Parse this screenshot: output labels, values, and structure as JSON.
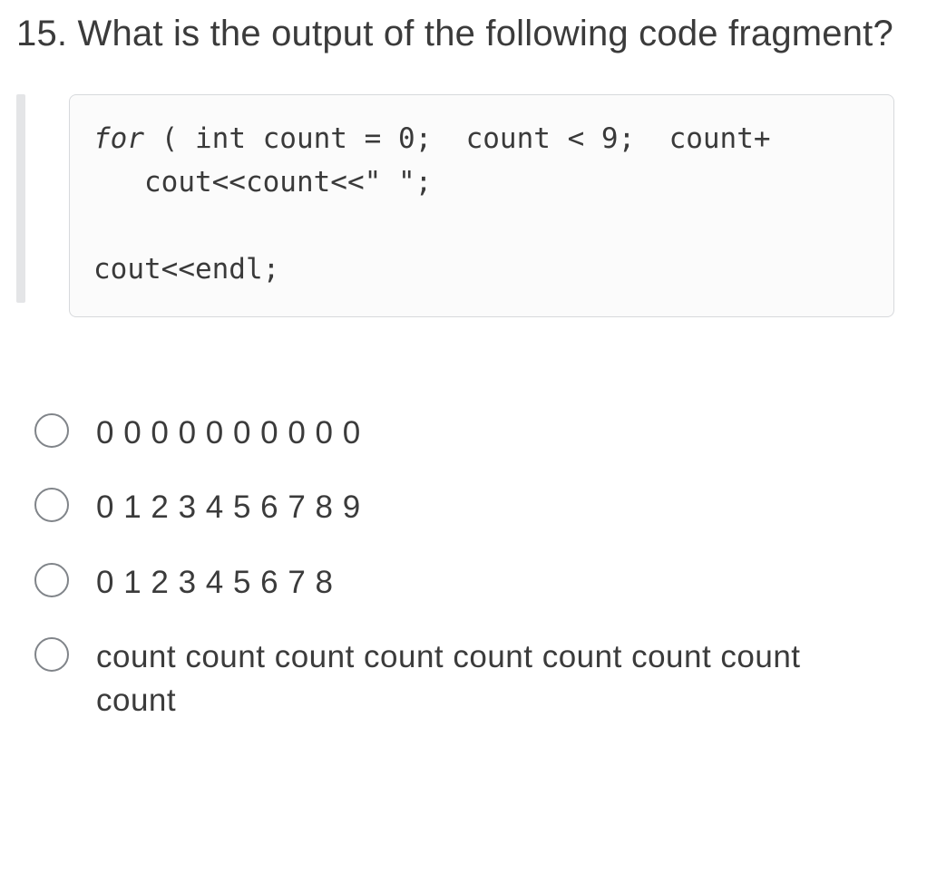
{
  "question": {
    "text": "15. What is the output of the following code fragment?"
  },
  "code": {
    "line1_a": "for",
    "line1_b": " ( int count = 0;  count < 9;  count+",
    "line2": "   cout<<count<<\" \";",
    "blank": "",
    "line3": "cout<<endl;"
  },
  "options": [
    {
      "label": "0 0 0 0 0 0 0 0 0 0"
    },
    {
      "label": "0 1 2 3 4 5 6 7 8 9"
    },
    {
      "label": "0 1 2 3 4 5 6 7 8"
    },
    {
      "label": "count count count count count count count count count"
    }
  ]
}
